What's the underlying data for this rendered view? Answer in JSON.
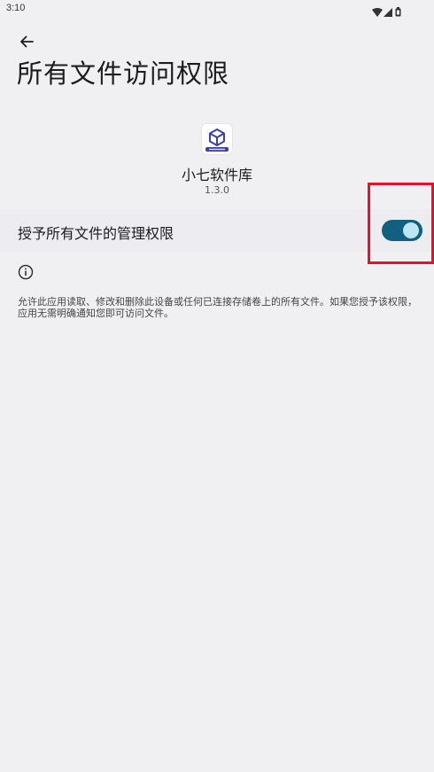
{
  "status_bar": {
    "time": "3:10",
    "icons": [
      "wifi-icon",
      "signal-icon",
      "battery-icon"
    ]
  },
  "header": {
    "back_icon": "arrow-left-icon",
    "title": "所有文件访问权限"
  },
  "app": {
    "icon": "cube-app-icon",
    "name": "小七软件库",
    "version": "1.3.0"
  },
  "permission": {
    "label": "授予所有文件的管理权限",
    "toggle_on": true
  },
  "info": {
    "icon": "info-icon",
    "description": "允许此应用读取、修改和删除此设备或任何已连接存储卷上的所有文件。如果您授予该权限，应用无需明确通知您即可访问文件。"
  },
  "colors": {
    "background": "#f0f0f3",
    "toggle_track": "#11607f",
    "toggle_thumb": "#bde6f5",
    "highlight": "#e3112b",
    "app_icon_accent": "#3b3fb5"
  }
}
